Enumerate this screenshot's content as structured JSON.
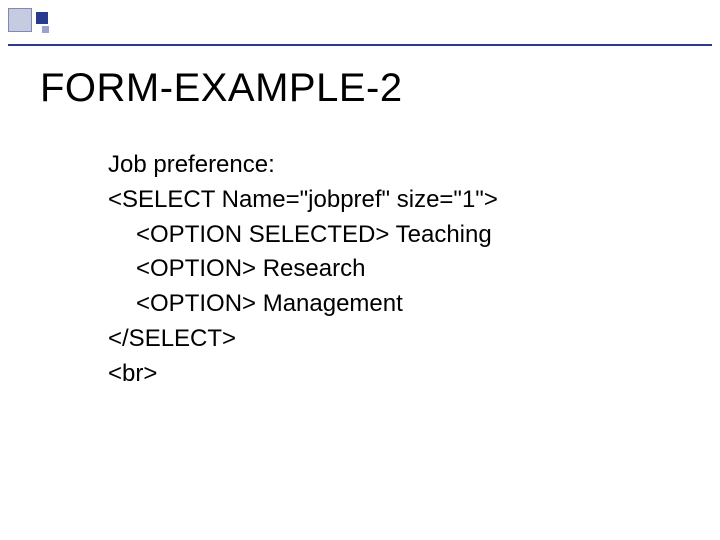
{
  "title": "FORM-EXAMPLE-2",
  "lines": {
    "l1": "Job preference:",
    "l2": "<SELECT Name=\"jobpref\" size=\"1\">",
    "l3": "<OPTION SELECTED> Teaching",
    "l4": "<OPTION> Research",
    "l5": "<OPTION> Management",
    "l6": "</SELECT>",
    "l7": "<br>"
  }
}
